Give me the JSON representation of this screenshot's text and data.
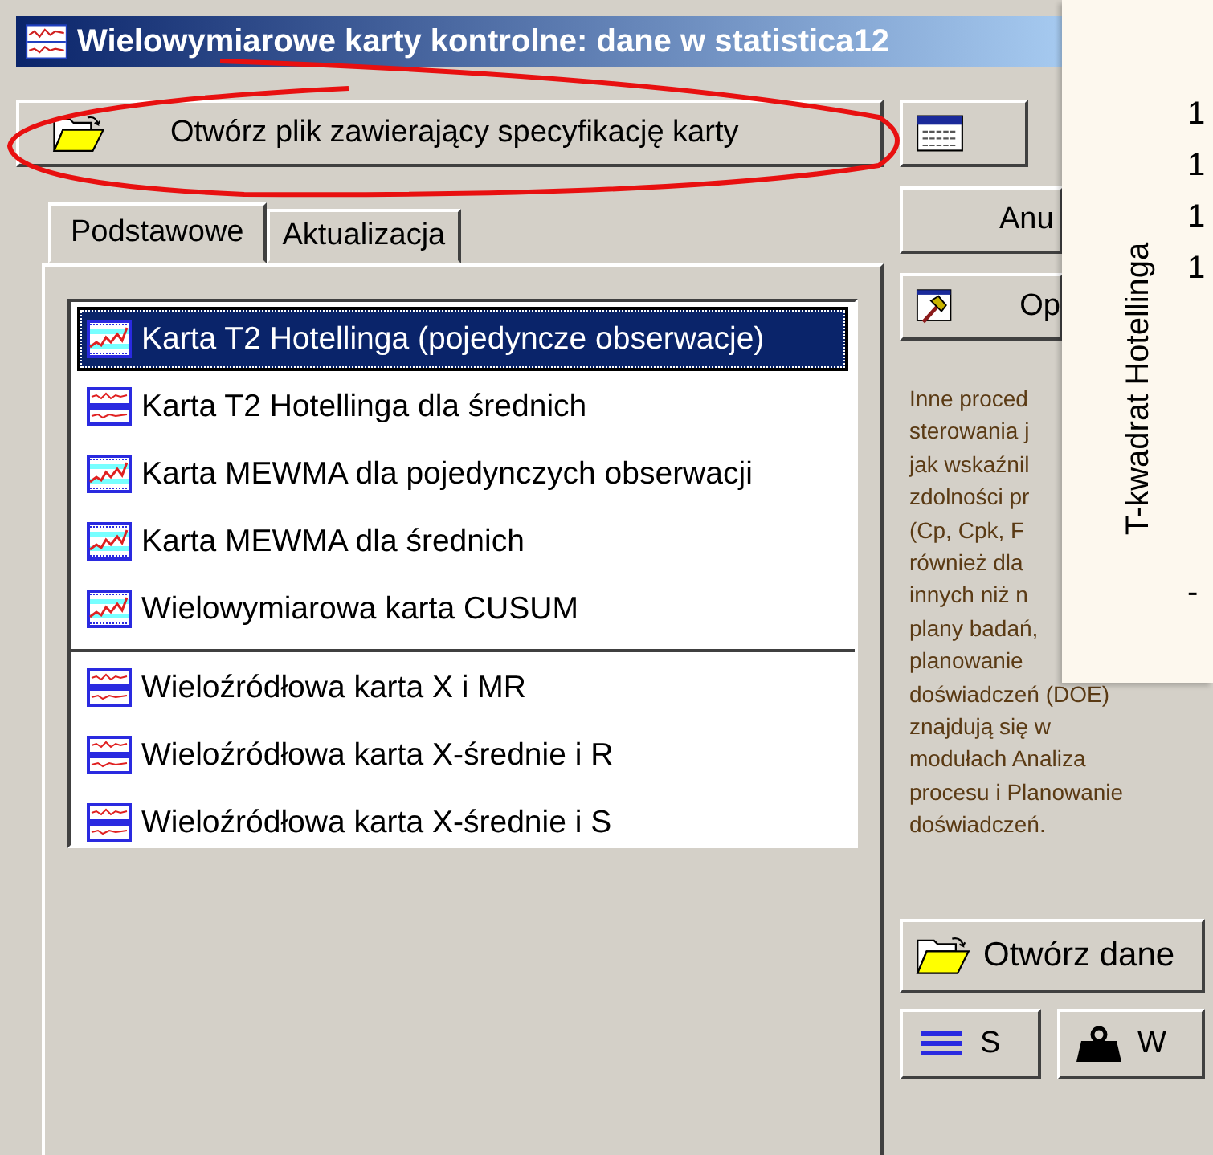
{
  "window": {
    "title": "Wielowymiarowe karty kontrolne: dane w statistica12"
  },
  "open_spec_button": {
    "label": "Otwórz plik zawierający specyfikację karty"
  },
  "tabs": [
    {
      "label": "Podstawowe",
      "selected": true
    },
    {
      "label": "Aktualizacja",
      "selected": false
    }
  ],
  "chart_groups": [
    {
      "items": [
        {
          "label": "Karta T2 Hotellinga (pojedyncze obserwacje)",
          "kind": "single",
          "selected": true
        },
        {
          "label": "Karta T2 Hotellinga dla średnich",
          "kind": "double",
          "selected": false
        },
        {
          "label": "Karta MEWMA dla pojedynczych obserwacji",
          "kind": "single",
          "selected": false
        },
        {
          "label": "Karta MEWMA dla średnich",
          "kind": "single",
          "selected": false
        },
        {
          "label": "Wielowymiarowa karta CUSUM",
          "kind": "single",
          "selected": false
        }
      ]
    },
    {
      "items": [
        {
          "label": "Wieloźródłowa karta X i MR",
          "kind": "double",
          "selected": false
        },
        {
          "label": "Wieloźródłowa karta X-średnie i R",
          "kind": "double",
          "selected": false
        },
        {
          "label": "Wieloźródłowa karta X-średnie i S",
          "kind": "double",
          "selected": false
        }
      ]
    }
  ],
  "side_buttons": [
    {
      "label": "Anu",
      "kind": "plain"
    },
    {
      "label": "Op",
      "kind": "hammer"
    }
  ],
  "info_lines": [
    "Inne proced",
    "sterowania j",
    "jak wskaźnil",
    "zdolności pr",
    "(Cp, Cpk, F",
    "również dla",
    "innych niż n",
    "plany badań,",
    "planowanie",
    "doświadczeń (DOE)",
    "znajdują się w",
    "modułach Analiza",
    "procesu i Planowanie",
    "doświadczeń."
  ],
  "open_data_button": {
    "label": "Otwórz dane"
  },
  "bottom_buttons": [
    {
      "label": "S",
      "kind": "select"
    },
    {
      "label": "W",
      "kind": "weight"
    }
  ],
  "overlay": {
    "axis_title": "T-kwadrat Hotellinga",
    "tick_labels": [
      "1",
      "1",
      "1",
      "1",
      "-"
    ]
  }
}
